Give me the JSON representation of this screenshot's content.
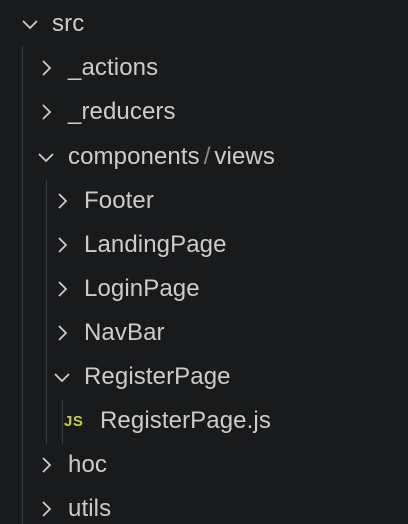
{
  "tree": {
    "root": {
      "label": "src",
      "icon": "chevron-down-icon",
      "expanded": true
    },
    "items": [
      {
        "label": "_actions",
        "icon": "chevron-right-icon",
        "expanded": false
      },
      {
        "label": "_reducers",
        "icon": "chevron-right-icon",
        "expanded": false
      },
      {
        "label_a": "components",
        "separator": "/",
        "label_b": "views",
        "icon": "chevron-down-icon",
        "expanded": true
      },
      {
        "label": "Footer",
        "icon": "chevron-right-icon",
        "expanded": false
      },
      {
        "label": "LandingPage",
        "icon": "chevron-right-icon",
        "expanded": false
      },
      {
        "label": "LoginPage",
        "icon": "chevron-right-icon",
        "expanded": false
      },
      {
        "label": "NavBar",
        "icon": "chevron-right-icon",
        "expanded": false
      },
      {
        "label": "RegisterPage",
        "icon": "chevron-down-icon",
        "expanded": true
      },
      {
        "label": "RegisterPage.js",
        "badge": "JS",
        "icon": "javascript-file-icon"
      },
      {
        "label": "hoc",
        "icon": "chevron-right-icon",
        "expanded": false
      },
      {
        "label": "utils",
        "icon": "chevron-right-icon",
        "expanded": false
      }
    ]
  },
  "colors": {
    "background": "#191a1c",
    "text": "#cccccc",
    "js_badge": "#cbcb41",
    "guide": "#3a3b3d"
  }
}
